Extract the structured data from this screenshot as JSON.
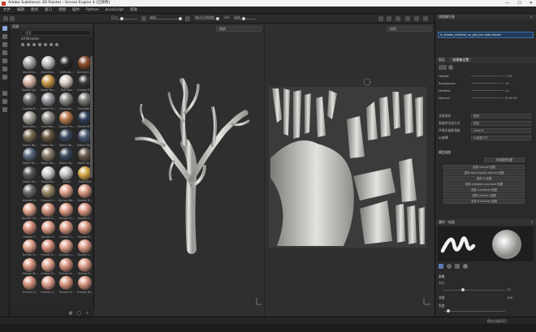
{
  "window": {
    "title": "Adobe Substance 3D Painter - Unreal Engine 4 (已修改)",
    "controls": [
      "—",
      "☐",
      "✕"
    ]
  },
  "menu": [
    "文件",
    "编辑",
    "模式",
    "窗口",
    "视图",
    "插件",
    "Python",
    "JavaScript",
    "帮助"
  ],
  "toolbar": {
    "size_label": "尺寸",
    "flow_label": "流量",
    "stroke_label": "描边不透明度",
    "spacing_label": "间距",
    "stroke_value": "100"
  },
  "shelf": {
    "title": "资源",
    "search_placeholder": "搜索",
    "filter_tag": "all libraries",
    "materials": [
      {
        "name": "Aluminiu...",
        "color": "#a9a9a9"
      },
      {
        "name": "Aluminiu...",
        "color": "#c2c2c2"
      },
      {
        "name": "Anthraci...",
        "color": "#2c2c2c"
      },
      {
        "name": "Autumn L...",
        "color": "#8a4a2a"
      },
      {
        "name": "Baked Lig...",
        "color": "#d9b8a8"
      },
      {
        "name": "Brass Pur...",
        "color": "#c89a4a"
      },
      {
        "name": "Calf Skin",
        "color": "#d9d0c5"
      },
      {
        "name": "Carbon Fi...",
        "color": "#383838"
      },
      {
        "name": "Coated M...",
        "color": "#6d6d6d"
      },
      {
        "name": "Cobalt Pu...",
        "color": "#9a9aa0"
      },
      {
        "name": "Concrete...",
        "color": "#8a8a86"
      },
      {
        "name": "Concrete...",
        "color": "#7a7a75"
      },
      {
        "name": "Concrete...",
        "color": "#a6a39c"
      },
      {
        "name": "Concrete...",
        "color": "#918d86"
      },
      {
        "name": "Copper Pu...",
        "color": "#b87a4e"
      },
      {
        "name": "Denim Ri...",
        "color": "#2e3f58"
      },
      {
        "name": "Fabric Ba...",
        "color": "#7a6b55"
      },
      {
        "name": "Fabric Ba...",
        "color": "#6b5840"
      },
      {
        "name": "Fabric Bo...",
        "color": "#3d4a60"
      },
      {
        "name": "Fabric De...",
        "color": "#4a5a72"
      },
      {
        "name": "Fabric Kn...",
        "color": "#5a6a80"
      },
      {
        "name": "Fabric Ro...",
        "color": "#8a7a6a"
      },
      {
        "name": "Fabric So...",
        "color": "#3a4a5c"
      },
      {
        "name": "Fabric Su...",
        "color": "#6a5a4a"
      },
      {
        "name": "Fabric Tw...",
        "color": "#5a5a5a"
      },
      {
        "name": "Footprint...",
        "color": "#d0d0d0"
      },
      {
        "name": "Glitter",
        "color": "#c8c8c8"
      },
      {
        "name": "Gold Pure",
        "color": "#d4a94a"
      },
      {
        "name": "Granite B...",
        "color": "#6a6a6a"
      },
      {
        "name": "Ground G...",
        "color": "#9a8a6a"
      },
      {
        "name": "Human Ba...",
        "color": "#e0a08a"
      },
      {
        "name": "Human B...",
        "color": "#dc9a85"
      },
      {
        "name": "Human Ch...",
        "color": "#e2a48e"
      },
      {
        "name": "Human E...",
        "color": "#d89580"
      },
      {
        "name": "Human E...",
        "color": "#e09c88"
      },
      {
        "name": "Human F...",
        "color": "#dd9884"
      },
      {
        "name": "Human F...",
        "color": "#d68f7a"
      },
      {
        "name": "Human F...",
        "color": "#e0a08a"
      },
      {
        "name": "Human F...",
        "color": "#db9985"
      },
      {
        "name": "Human F...",
        "color": "#d99480"
      },
      {
        "name": "Human H...",
        "color": "#e1a18c"
      },
      {
        "name": "Human K...",
        "color": "#d8927e"
      },
      {
        "name": "Human L...",
        "color": "#de9d88"
      },
      {
        "name": "Human L...",
        "color": "#dc9a86"
      },
      {
        "name": "Human M...",
        "color": "#d99682"
      },
      {
        "name": "Human N...",
        "color": "#e0a08c"
      },
      {
        "name": "Human N...",
        "color": "#d6917c"
      },
      {
        "name": "Human P...",
        "color": "#dd9b87"
      },
      {
        "name": "Human S...",
        "color": "#d89480"
      },
      {
        "name": "Human S...",
        "color": "#e2a28e"
      },
      {
        "name": "Human S...",
        "color": "#da9783"
      },
      {
        "name": "Human W...",
        "color": "#dc9985"
      }
    ]
  },
  "viewport": {
    "left_mode": "材质",
    "right_mode": "材质"
  },
  "texture_set": {
    "title": "纹理集列表",
    "item": "ui_shader_material_ue_grid_tex  data shader"
  },
  "properties": {
    "tabs": [
      "图层",
      "纹理集设置"
    ],
    "channels": [
      {
        "name": "Height",
        "val": "L16F"
      },
      {
        "name": "Roughness",
        "val": "L8"
      },
      {
        "name": "Metallic",
        "val": "L8"
      },
      {
        "name": "Normal",
        "val": "RGB16F"
      }
    ],
    "settings": [
      {
        "label": "法线混合",
        "value": "替换"
      },
      {
        "label": "高度转法线方式",
        "value": "屏幕"
      },
      {
        "label": "环境光遮蔽强度",
        "value": "Default"
      },
      {
        "label": "ID遮罩",
        "value": "ID遮罩方式"
      }
    ],
    "bake_title": "模型贴图",
    "bake_button": "烘焙模型贴图",
    "bake_maps": [
      "选择 normal 贴图",
      "选择 world space normal 贴图",
      "选择 id 贴图",
      "选择 ambient occlusion 贴图",
      "选择 curvature 贴图",
      "选择 position 贴图",
      "选择 thickness 贴图"
    ]
  },
  "brush": {
    "title": "属性 - 绘画",
    "section": "画笔",
    "size_label": "大小",
    "size_value": "12",
    "flow_label": "流量",
    "flow_value": "100",
    "angle_label": "角度"
  },
  "status": {
    "left": "",
    "right": "保存当前项目"
  }
}
